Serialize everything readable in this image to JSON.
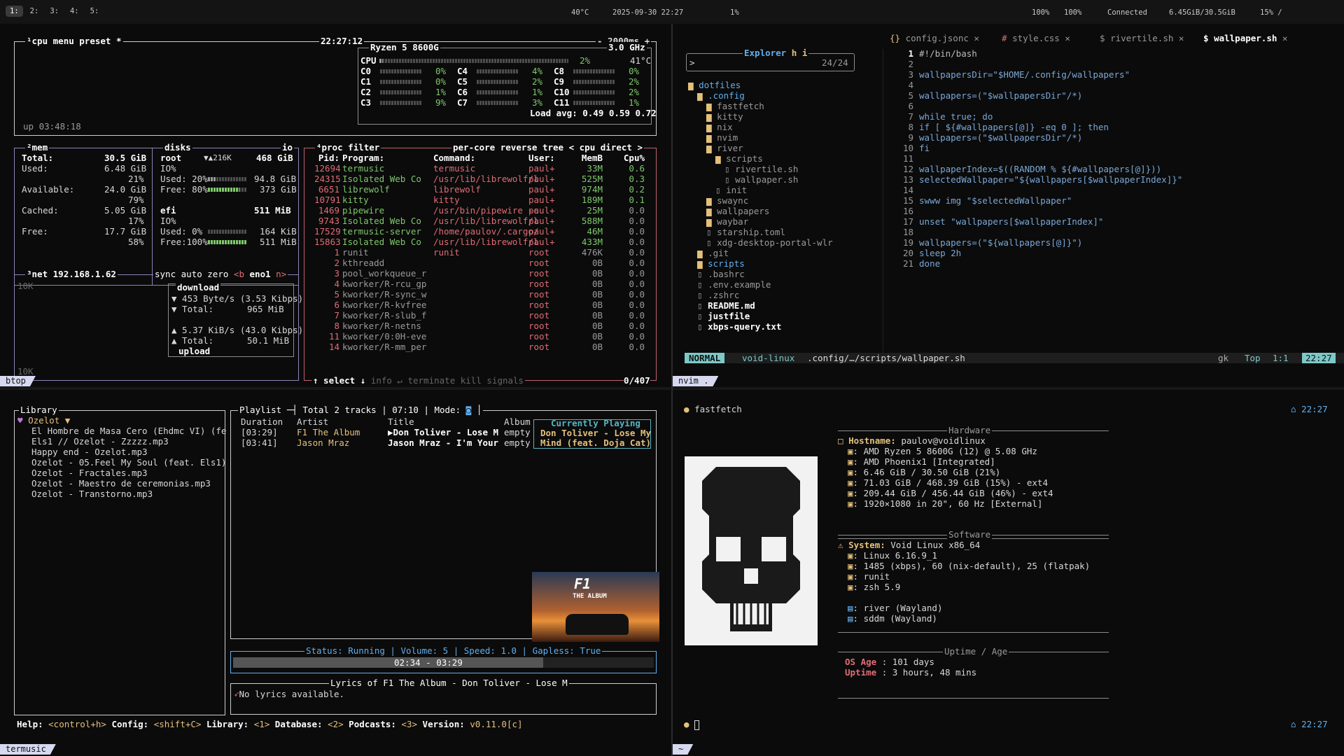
{
  "topbar": {
    "tags": [
      "1:",
      "2:",
      "3:",
      "4:",
      "5:"
    ],
    "temp": "40°C",
    "datetime": "2025-09-30 22:27",
    "cpu": "1%",
    "vol_a": "100%",
    "vol_b": "100%",
    "network": "Connected",
    "mem": "6.45GiB/30.5GiB",
    "disk": "15% /"
  },
  "btop": {
    "label": "btop",
    "cpu_title": "¹cpu",
    "menu": "menu",
    "preset": "preset *",
    "clock": "22:27:12",
    "interval": "- 2000ms +",
    "cpu_model": "Ryzen 5 8600G",
    "freq": "3.0 GHz",
    "cpu_total_label": "CPU",
    "cpu_total_pct": "2%",
    "cpu_temp": "41°C",
    "cpu_total_value": 0.02,
    "cores": [
      {
        "name": "C0",
        "pct": "0%"
      },
      {
        "name": "C4",
        "pct": "4%"
      },
      {
        "name": "C8",
        "pct": "0%"
      },
      {
        "name": "C1",
        "pct": "0%"
      },
      {
        "name": "C5",
        "pct": "2%"
      },
      {
        "name": "C9",
        "pct": "2%"
      },
      {
        "name": "C2",
        "pct": "1%"
      },
      {
        "name": "C6",
        "pct": "1%"
      },
      {
        "name": "C10",
        "pct": "2%"
      },
      {
        "name": "C3",
        "pct": "9%"
      },
      {
        "name": "C7",
        "pct": "3%"
      },
      {
        "name": "C11",
        "pct": "1%"
      }
    ],
    "load": "Load avg: 0.49 0.59 0.72",
    "uptime": "up 03:48:18",
    "mem_title": "²mem",
    "mem": {
      "total_l": "Total:",
      "total": "30.5 GiB",
      "used_l": "Used:",
      "used": "6.48 GiB",
      "used_pct": "21%",
      "avail_l": "Available:",
      "avail": "24.0 GiB",
      "avail_pct": "79%",
      "cached_l": "Cached:",
      "cached": "5.05 GiB",
      "cached_pct": "17%",
      "free_l": "Free:",
      "free": "17.7 GiB",
      "free_pct": "58%"
    },
    "disks_title": "disks",
    "io": "io",
    "root": {
      "name": "root",
      "speed": "▼▲216K",
      "size": "468 GiB",
      "io": "IO%",
      "used": "Used: 20%",
      "used_v": "94.8 GiB",
      "free": "Free: 80%",
      "free_v": "373 GiB",
      "used_frac": 0.2,
      "free_frac": 0.8
    },
    "efi": {
      "name": "efi",
      "size": "511 MiB",
      "io": "IO%",
      "used": "Used:  0%",
      "used_v": "164 KiB",
      "free": "Free:100%",
      "free_v": "511 MiB",
      "used_frac": 0.0,
      "free_frac": 1.0
    },
    "net_title": "³net",
    "net_ip": "192.168.1.62",
    "net_sync": "sync",
    "net_auto": "auto",
    "net_zero": "zero",
    "net_b": "<b",
    "net_iface": "eno1",
    "net_n": "n>",
    "net_scale_top": "10K",
    "net_scale_bot": "10K",
    "download": "download",
    "down_rate": "▼ 453 Byte/s (3.53 Kibps)",
    "down_total_l": "▼ Total:",
    "down_total": "965 MiB",
    "up_rate": "▲ 5.37 KiB/s (43.0 Kibps)",
    "up_total_l": "▲ Total:",
    "up_total": "50.1 MiB",
    "upload": "upload",
    "proc_title": "⁴proc",
    "filter": "filter",
    "per_core": "per-core",
    "reverse": "reverse",
    "tree": "tree",
    "sort": "< cpu direct >",
    "headers": [
      "Pid:",
      "Program:",
      "Command:",
      "User:",
      "MemB",
      "Cpu%"
    ],
    "procs": [
      [
        "12694",
        "termusic",
        "termusic",
        "paul+",
        "33M",
        "0.6"
      ],
      [
        "24315",
        "Isolated Web Co",
        "/usr/lib/librewolf/l",
        "paul+",
        "525M",
        "0.3"
      ],
      [
        "6651",
        "librewolf",
        "librewolf",
        "paul+",
        "974M",
        "0.2"
      ],
      [
        "10791",
        "kitty",
        "kitty",
        "paul+",
        "189M",
        "0.1"
      ],
      [
        "1469",
        "pipewire",
        "/usr/bin/pipewire -c",
        "paul+",
        "25M",
        "0.0"
      ],
      [
        "9743",
        "Isolated Web Co",
        "/usr/lib/librewolf/l",
        "paul+",
        "588M",
        "0.0"
      ],
      [
        "17529",
        "termusic-server",
        "/home/paulov/.cargo/",
        "paul+",
        "46M",
        "0.0"
      ],
      [
        "15863",
        "Isolated Web Co",
        "/usr/lib/librewolf/l",
        "paul+",
        "433M",
        "0.0"
      ],
      [
        "1",
        "runit",
        "runit",
        "root",
        "476K",
        "0.0"
      ],
      [
        "2",
        "kthreadd",
        "",
        "root",
        "0B",
        "0.0"
      ],
      [
        "3",
        "pool_workqueue_r",
        "",
        "root",
        "0B",
        "0.0"
      ],
      [
        "4",
        "kworker/R-rcu_gp",
        "",
        "root",
        "0B",
        "0.0"
      ],
      [
        "5",
        "kworker/R-sync_w",
        "",
        "root",
        "0B",
        "0.0"
      ],
      [
        "6",
        "kworker/R-kvfree",
        "",
        "root",
        "0B",
        "0.0"
      ],
      [
        "7",
        "kworker/R-slub_f",
        "",
        "root",
        "0B",
        "0.0"
      ],
      [
        "8",
        "kworker/R-netns",
        "",
        "root",
        "0B",
        "0.0"
      ],
      [
        "11",
        "kworker/0:0H-eve",
        "",
        "root",
        "0B",
        "0.0"
      ],
      [
        "14",
        "kworker/R-mm_per",
        "",
        "root",
        "0B",
        "0.0"
      ]
    ],
    "proc_select": "↑ select ↓",
    "proc_info": "info ↵",
    "proc_terminate": "terminate",
    "proc_kill": "kill",
    "proc_signals": "signals",
    "proc_count": "0/407"
  },
  "nvim": {
    "label": "nvim .",
    "tabs": [
      "config.jsonc",
      "style.css",
      "rivertile.sh",
      "wallpaper.sh"
    ],
    "explorer": "Explorer",
    "explorer_h": "h",
    "explorer_i": "i",
    "search_prompt": ">",
    "count": "24/24",
    "tree": [
      {
        "t": "dotfiles",
        "c": "bl"
      },
      {
        "t": ".config",
        "c": "bl"
      },
      {
        "t": "fastfetch",
        "c": "g"
      },
      {
        "t": "kitty",
        "c": "g"
      },
      {
        "t": "nix",
        "c": "g"
      },
      {
        "t": "nvim",
        "c": "g"
      },
      {
        "t": "river",
        "c": "g"
      },
      {
        "t": "scripts",
        "c": "g"
      },
      {
        "t": "rivertile.sh",
        "c": "g"
      },
      {
        "t": "wallpaper.sh",
        "c": "g"
      },
      {
        "t": "init",
        "c": "g"
      },
      {
        "t": "swaync",
        "c": "g"
      },
      {
        "t": "wallpapers",
        "c": "g"
      },
      {
        "t": "waybar",
        "c": "g"
      },
      {
        "t": "starship.toml",
        "c": "g"
      },
      {
        "t": "xdg-desktop-portal-wlr",
        "c": "g"
      },
      {
        "t": ".git",
        "c": "g"
      },
      {
        "t": "scripts",
        "c": "bl"
      },
      {
        "t": ".bashrc",
        "c": "g"
      },
      {
        "t": ".env.example",
        "c": "g"
      },
      {
        "t": ".zshrc",
        "c": "g"
      },
      {
        "t": "README.md",
        "c": "w"
      },
      {
        "t": "justfile",
        "c": "w"
      },
      {
        "t": "xbps-query.txt",
        "c": "w"
      }
    ],
    "code": [
      "#!/bin/bash",
      "",
      "wallpapersDir=\"$HOME/.config/wallpapers\"",
      "",
      "wallpapers=(\"$wallpapersDir\"/*)",
      "",
      "while true; do",
      "  if [ ${#wallpapers[@]} -eq 0 ]; then",
      "    wallpapers=(\"$wallpapersDir\"/*)",
      "  fi",
      "",
      "  wallpaperIndex=$((RANDOM % ${#wallpapers[@]}))",
      "  selectedWallpaper=\"${wallpapers[$wallpaperIndex]}\"",
      "",
      "  swww img \"$selectedWallpaper\"",
      "",
      "  unset \"wallpapers[$wallpaperIndex]\"",
      "",
      "  wallpapers=(\"${wallpapers[@]}\")",
      "  sleep 2h",
      "done"
    ],
    "mode": "NORMAL",
    "branch": "void-linux",
    "path": ".config/…/scripts/wallpaper.sh",
    "keys": "gk",
    "pos": "Top",
    "cursor": "1:1",
    "time": "22:27"
  },
  "termusic": {
    "label": "termusic",
    "library": "Library",
    "folder": "Ozelot ▼",
    "library_items": [
      "El Hombre de Masa Cero (Ehdmc VI) (fe",
      "Els1 // Ozelot - Zzzzz.mp3",
      "Happy end - Ozelot.mp3",
      "Ozelot - 05.Feel My Soul (feat. Els1)",
      "Ozelot - Fractales.mp3",
      "Ozelot - Maestro de ceremonias.mp3",
      "Ozelot - Transtorno.mp3"
    ],
    "playlist": "Playlist",
    "total": "Total 2 tracks | 07:10 | Mode:",
    "cols": [
      "Duration",
      "Artist",
      "Title",
      "Album"
    ],
    "tracks": [
      [
        "[03:29]",
        "F1 The Album",
        "▶Don Toliver - Lose M",
        "empty"
      ],
      [
        "[03:41]",
        "Jason Mraz",
        "Jason Mraz - I'm Your",
        "empty"
      ]
    ],
    "current_title": "Currently Playing",
    "current_l1": "Don Toliver - Lose My",
    "current_l2": "Mind (feat. Doja Cat)",
    "album_art_title": "THE ALBUM",
    "status": "Status: Running | Volume: 5 | Speed: 1.0 | Gapless: True",
    "elapsed": "02:34",
    "sep": "-",
    "duration": "03:29",
    "progress": 0.737,
    "lyrics_title": "Lyrics of F1 The Album - Don Toliver - Lose M",
    "lyrics": "No lyrics available.",
    "help": [
      {
        "k": "Help:",
        "v": "<control+h>"
      },
      {
        "k": "Config:",
        "v": "<shift+C>"
      },
      {
        "k": "Library:",
        "v": "<1>"
      },
      {
        "k": "Database:",
        "v": "<2>"
      },
      {
        "k": "Podcasts:",
        "v": "<3>"
      },
      {
        "k": "Version:",
        "v": "v0.11.0[c]"
      }
    ]
  },
  "fastfetch": {
    "label": "~",
    "prompt": "fastfetch",
    "time": "22:27",
    "hardware": "Hardware",
    "hostname_l": "Hostname:",
    "hostname": "paulov@voidlinux",
    "hw": [
      ": AMD Ryzen 5 8600G (12) @ 5.08 GHz",
      ": AMD Phoenix1 [Integrated]",
      ": 6.46 GiB / 30.50 GiB (21%)",
      ": 71.03 GiB / 468.39 GiB (15%) - ext4",
      ": 209.44 GiB / 456.44 GiB (46%) - ext4",
      ": 1920×1080 in 20\", 60 Hz [External]"
    ],
    "software": "Software",
    "system_l": "System:",
    "system": "Void Linux x86_64",
    "sw": [
      ": Linux 6.16.9_1",
      ": 1485 (xbps), 60 (nix-default), 25 (flatpak)",
      ": runit",
      ": zsh 5.9"
    ],
    "wm": [
      ": river (Wayland)",
      ": sddm (Wayland)"
    ],
    "uptime_title": "Uptime / Age",
    "os_age_l": "OS Age",
    "os_age": ": 101 days",
    "uptime_l": "Uptime",
    "uptime": ": 3 hours, 48 mins",
    "time2": "22:27"
  }
}
